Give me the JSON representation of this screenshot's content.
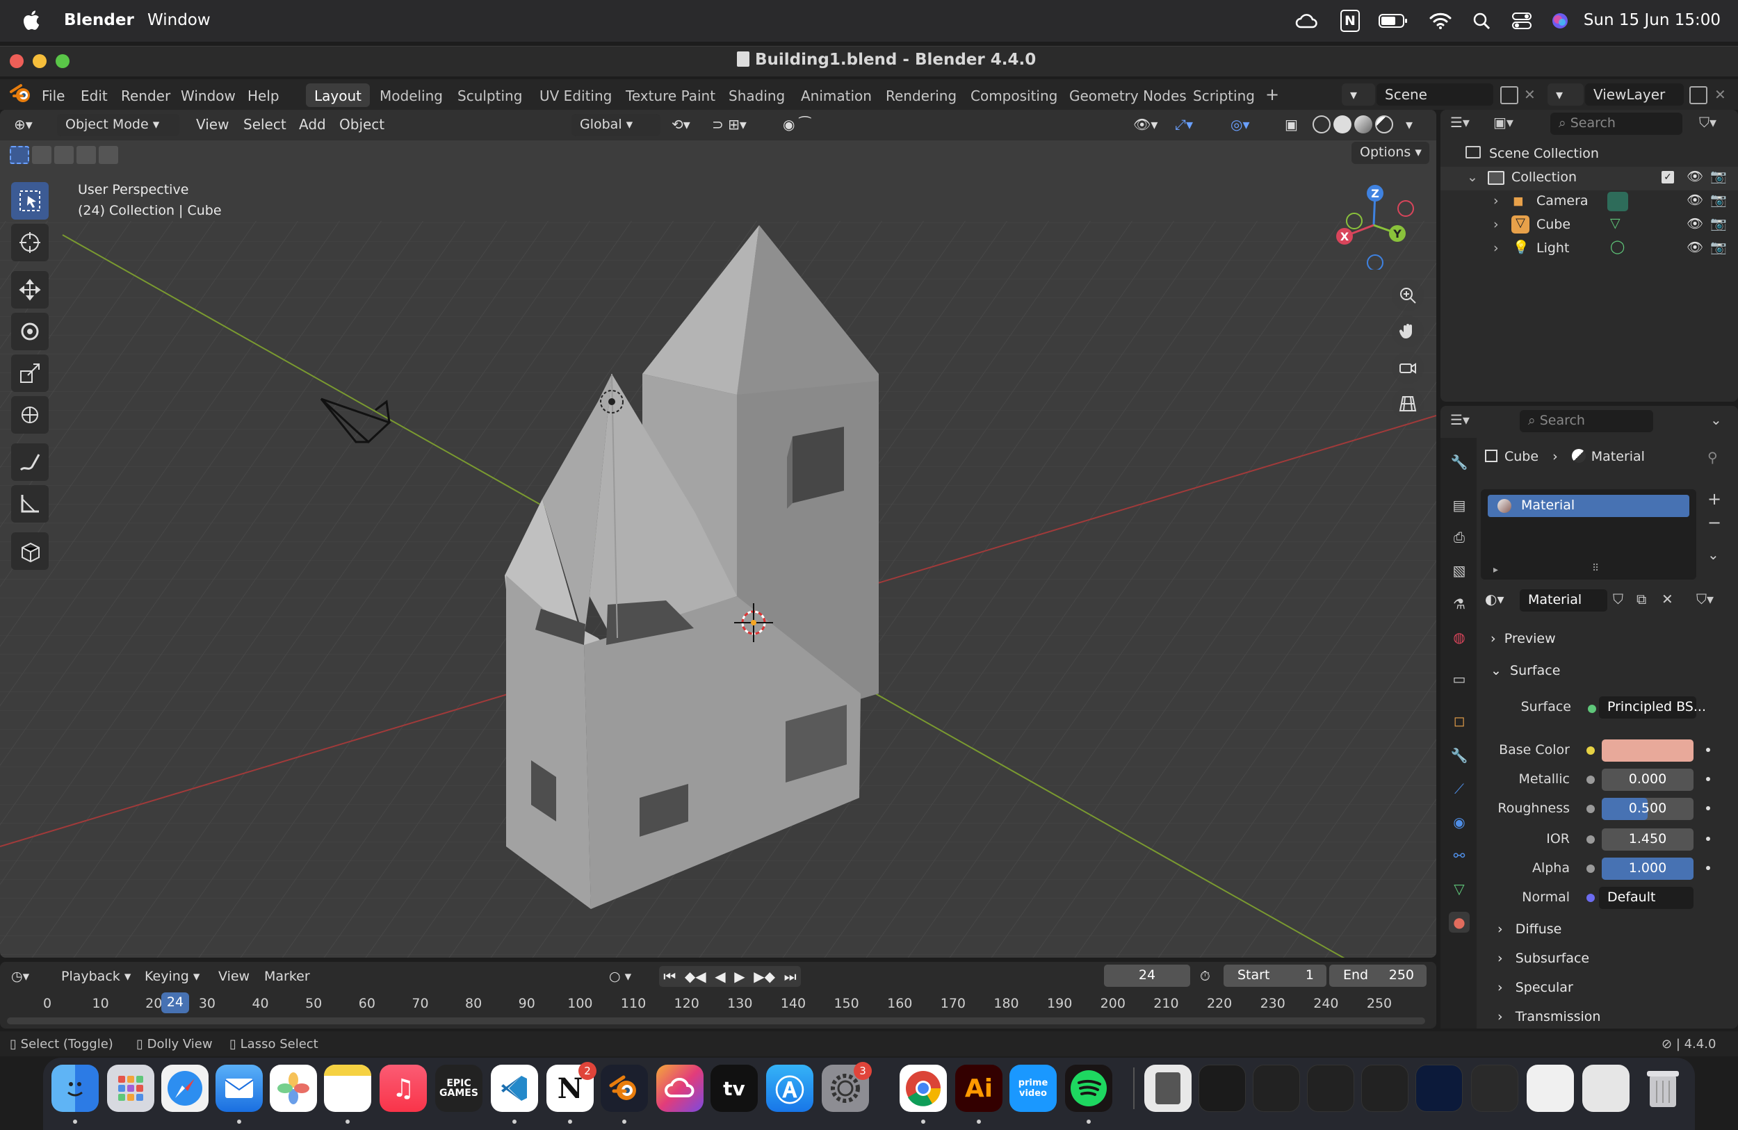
{
  "menubar": {
    "app_name": "Blender",
    "window_menu": "Window",
    "clock": "Sun 15 Jun  15:00",
    "n_icon": "N"
  },
  "window": {
    "title": "Building1.blend - Blender 4.4.0"
  },
  "topbar": {
    "menus": [
      "File",
      "Edit",
      "Render",
      "Window",
      "Help"
    ],
    "workspaces": [
      "Layout",
      "Modeling",
      "Sculpting",
      "UV Editing",
      "Texture Paint",
      "Shading",
      "Animation",
      "Rendering",
      "Compositing",
      "Geometry Nodes",
      "Scripting"
    ],
    "active_workspace": "Layout",
    "scene": "Scene",
    "view_layer": "ViewLayer"
  },
  "viewport": {
    "mode": "Object Mode",
    "menus": [
      "View",
      "Select",
      "Add",
      "Object"
    ],
    "transform_orientation": "Global",
    "options_label": "Options",
    "overlay_line1": "User Perspective",
    "overlay_line2": "(24) Collection | Cube",
    "gizmo_axes": {
      "x": "X",
      "y": "Y",
      "z": "Z"
    }
  },
  "outliner": {
    "search_placeholder": "Search",
    "scene_collection": "Scene Collection",
    "collection": "Collection",
    "items": [
      "Camera",
      "Cube",
      "Light"
    ]
  },
  "properties": {
    "search_placeholder": "Search",
    "breadcrumb_object": "Cube",
    "breadcrumb_data": "Material",
    "slot_name": "Material",
    "material_name": "Material",
    "panels": {
      "preview": "Preview",
      "surface": "Surface"
    },
    "surface_label": "Surface",
    "surface_value": "Principled BS...",
    "rows": [
      {
        "label": "Base Color",
        "value": ""
      },
      {
        "label": "Metallic",
        "value": "0.000"
      },
      {
        "label": "Roughness",
        "value": "0.500"
      },
      {
        "label": "IOR",
        "value": "1.450"
      },
      {
        "label": "Alpha",
        "value": "1.000"
      },
      {
        "label": "Normal",
        "value": "Default"
      }
    ],
    "subpanels": [
      "Diffuse",
      "Subsurface",
      "Specular",
      "Transmission"
    ],
    "base_color": "#e8a99a",
    "roughness_fraction": 0.5,
    "alpha_fraction": 1.0
  },
  "timeline": {
    "menus": [
      "Playback",
      "Keying",
      "View",
      "Marker"
    ],
    "current_frame": "24",
    "start_label": "Start",
    "start_value": "1",
    "end_label": "End",
    "end_value": "250",
    "ticks": [
      "0",
      "10",
      "20",
      "30",
      "40",
      "50",
      "60",
      "70",
      "80",
      "90",
      "100",
      "110",
      "120",
      "130",
      "140",
      "150",
      "160",
      "170",
      "180",
      "190",
      "200",
      "210",
      "220",
      "230",
      "240",
      "250"
    ],
    "playhead": "24"
  },
  "statusbar": {
    "select": "Select (Toggle)",
    "dolly": "Dolly View",
    "lasso": "Lasso Select",
    "version": "4.4.0"
  },
  "dock": {
    "epic_label": "EPIC\nGAMES",
    "tv_label": "tv",
    "prime_label": "prime\nvideo",
    "ai_label": "Ai",
    "notion_label": "N",
    "notion_badge": "2",
    "settings_badge": "3"
  },
  "colors": {
    "accent": "#4772b3",
    "active_tool": "#3c5b94",
    "axis_x": "#d9455b",
    "axis_y": "#8ac23b",
    "axis_z": "#3f82e0"
  }
}
